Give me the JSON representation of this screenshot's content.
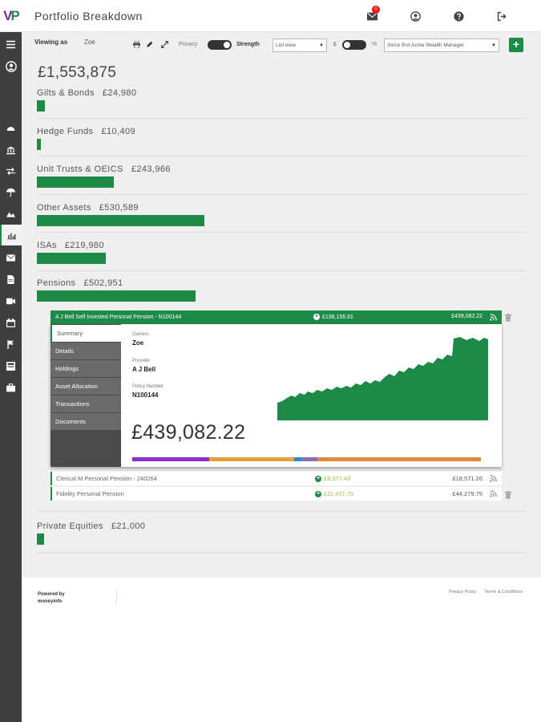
{
  "app": {
    "logo_v": "V",
    "logo_p": "P",
    "title": "Portfolio Breakdown"
  },
  "header": {
    "message_count": "0"
  },
  "toolbar": {
    "viewing_label": "Viewing as",
    "viewing_name": "Zoe",
    "privacy_label": "Privacy",
    "strength_label": "Strength",
    "view_select": "List view",
    "currency_symbol": "£",
    "percent_symbol": "%",
    "period_select": "Since first Acme Wealth Manager",
    "add_label": "+"
  },
  "portfolio": {
    "total": "£1,553,875",
    "categories": [
      {
        "name": "Gilts & Bonds",
        "amount": "£24,980",
        "share": 0.016
      },
      {
        "name": "Hedge Funds",
        "amount": "£10,409",
        "share": 0.007
      },
      {
        "name": "Unit Trusts & OEICS",
        "amount": "£243,966",
        "share": 0.157
      },
      {
        "name": "Other Assets",
        "amount": "£530,589",
        "share": 0.341
      },
      {
        "name": "ISAs",
        "amount": "£219,980",
        "share": 0.142
      },
      {
        "name": "Pensions",
        "amount": "£502,951",
        "share": 0.324
      },
      {
        "name": "Private Equities",
        "amount": "£21,000",
        "share": 0.014
      }
    ]
  },
  "pension_detail": {
    "name": "A J Bell Self Invested Personal Pension - N100144",
    "growth": "£138,156.81",
    "value": "£439,082.22",
    "tabs": [
      "Summary",
      "Details",
      "Holdings",
      "Asset Allocation",
      "Transactions",
      "Documents"
    ],
    "owners_label": "Owners",
    "owners": "Zoe",
    "provider_label": "Provider",
    "provider": "A J Bell",
    "policy_label": "Policy Number",
    "policy": "N100144",
    "big_value": "£439,082.22",
    "allocation": [
      {
        "share": 0.22,
        "color": "#8e2bc9"
      },
      {
        "share": 0.245,
        "color": "#e0a23d"
      },
      {
        "share": 0.02,
        "color": "#2d8ec4"
      },
      {
        "share": 0.045,
        "color": "#8a6fb3"
      },
      {
        "share": 0.47,
        "color": "#e08a3d"
      }
    ],
    "chart_color": "#1e8a47"
  },
  "pensions_other": [
    {
      "name": "Clerical M Personal Pension - 240264",
      "growth": "£8,377.40",
      "value": "£18,571.26"
    },
    {
      "name": "Fidelity Personal Pension",
      "growth": "£11,437.75",
      "value": "£44,279.75"
    }
  ],
  "footer": {
    "powered_line1": "Powered by",
    "powered_line2": "moneyinfo",
    "privacy_link": "Privacy Policy",
    "terms_link": "Terms & Conditions"
  }
}
